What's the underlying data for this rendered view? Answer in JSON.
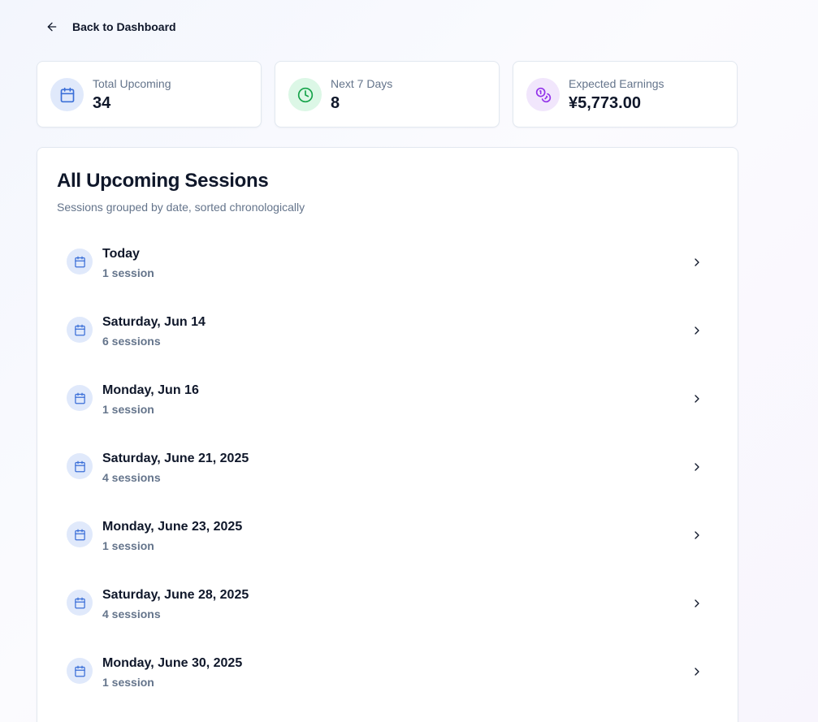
{
  "nav": {
    "back_label": "Back to Dashboard"
  },
  "stats": [
    {
      "label": "Total Upcoming",
      "value": "34",
      "icon": "calendar-icon",
      "bg": "#e0e9fb",
      "color": "#3b6fd8"
    },
    {
      "label": "Next 7 Days",
      "value": "8",
      "icon": "clock-icon",
      "bg": "#dcf7e6",
      "color": "#16a34a"
    },
    {
      "label": "Expected Earnings",
      "value": "¥5,773.00",
      "icon": "coins-icon",
      "bg": "#f1e6fc",
      "color": "#9333ea"
    }
  ],
  "sessions": {
    "title": "All Upcoming Sessions",
    "subtitle": "Sessions grouped by date, sorted chronologically",
    "groups": [
      {
        "date": "Today",
        "count": "1 session"
      },
      {
        "date": "Saturday, Jun 14",
        "count": "6 sessions"
      },
      {
        "date": "Monday, Jun 16",
        "count": "1 session"
      },
      {
        "date": "Saturday, June 21, 2025",
        "count": "4 sessions"
      },
      {
        "date": "Monday, June 23, 2025",
        "count": "1 session"
      },
      {
        "date": "Saturday, June 28, 2025",
        "count": "4 sessions"
      },
      {
        "date": "Monday, June 30, 2025",
        "count": "1 session"
      }
    ]
  }
}
